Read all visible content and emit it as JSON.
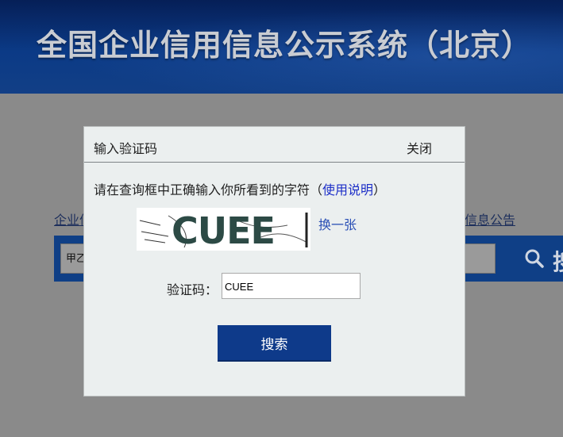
{
  "banner": {
    "title": "全国企业信用信息公示系统（北京）"
  },
  "nav": {
    "left_link": "企业信",
    "right_link": "信息公告"
  },
  "search": {
    "value": "甲乙",
    "button_label": "搜"
  },
  "modal": {
    "title": "输入验证码",
    "close_label": "关闭",
    "instruction_prefix": "请在查询框中正确输入你所看到的字符（",
    "help_link": "使用说明",
    "instruction_suffix": "）",
    "captcha_text": "CUEE",
    "refresh_link": "换一张",
    "code_label": "验证码：",
    "code_value": "CUEE",
    "submit_label": "搜索"
  },
  "colors": {
    "banner_blue": "#0b3a86",
    "button_blue": "#0e3a8a",
    "link_blue": "#1d2fc8"
  }
}
